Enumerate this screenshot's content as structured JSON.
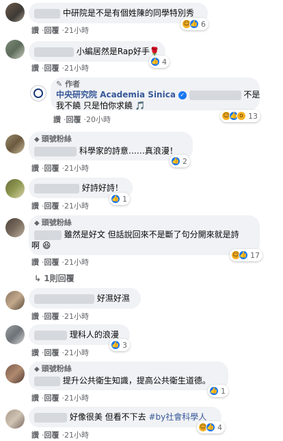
{
  "actions": {
    "like": "讚",
    "reply": "回覆",
    "sep": "·"
  },
  "comments": [
    {
      "text": "中研院是不是有個姓陳的同學特別秀",
      "time": "21小時",
      "reaction_count": "6"
    },
    {
      "text": "小編居然是Rap好手🌹",
      "time": "21小時",
      "reaction_count": "4"
    },
    {
      "author_tag": "作者",
      "author_name": "中央研究院 Academia Sinica",
      "line1_suffix": "不是",
      "line2": "我不饒 只是怕你求饒 🎵",
      "time": "20小時",
      "reaction_count": "13"
    },
    {
      "badge": "頭號粉絲",
      "text": "科學家的詩意……真浪漫！",
      "time": "21小時",
      "reaction_count": "2"
    },
    {
      "text": "好詩好詩！",
      "time": "21小時",
      "reaction_count": "1"
    },
    {
      "badge": "頭號粉絲",
      "line1": "雖然是好文 但話說回來不是斷了句分開來就是詩",
      "line2": "啊 😆",
      "time": "21小時",
      "reaction_count": "17"
    },
    {
      "replies_link": "1則回覆"
    },
    {
      "text": "好濕好濕",
      "time": "21小時"
    },
    {
      "text": "理科人的浪漫",
      "time": "21小時",
      "reaction_count": "3"
    },
    {
      "badge": "頭號粉絲",
      "text": "提升公共衛生知識，提高公共衛生道德。",
      "time": "21小時",
      "reaction_count": "1"
    },
    {
      "text": "好像很美 但看不下去 ",
      "hashtag": "#by社會科學人",
      "time": "21小時",
      "reaction_count": "4"
    }
  ],
  "colors": {
    "link": "#385898",
    "bubble": "#f0f2f5",
    "meta": "#65676b",
    "like": "#1877f2"
  }
}
